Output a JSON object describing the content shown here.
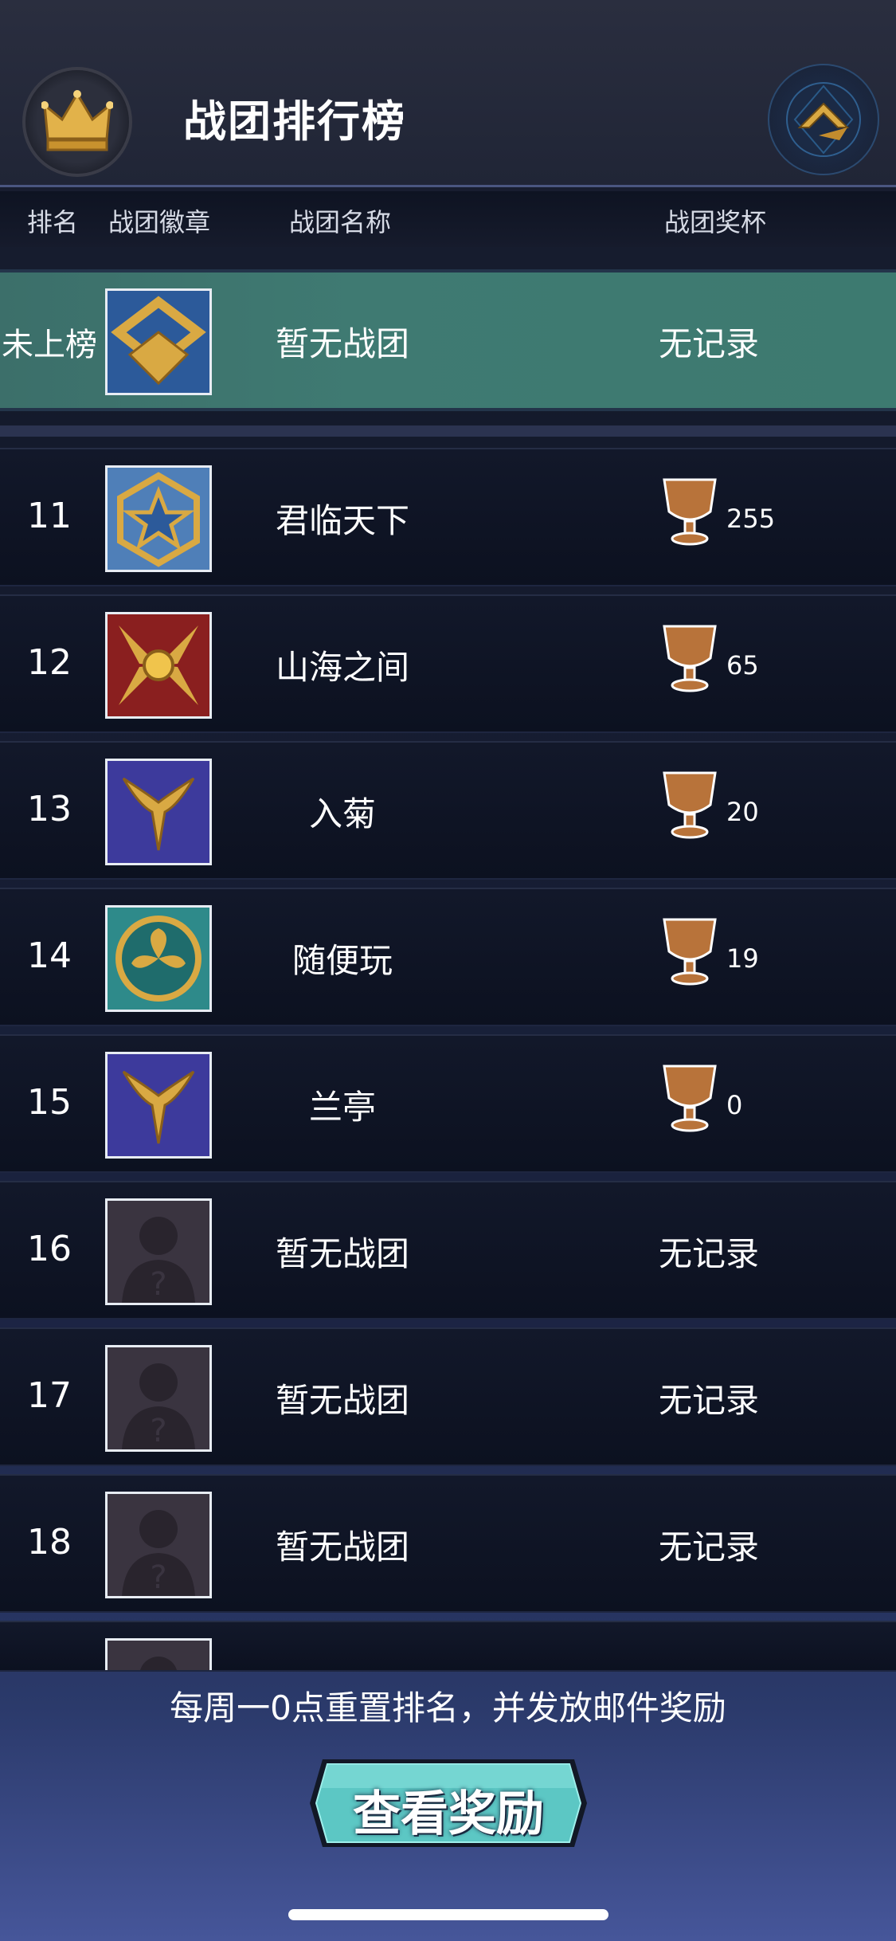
{
  "header": {
    "title": "战团排行榜"
  },
  "columns": {
    "rank": "排名",
    "badge": "战团徽章",
    "name": "战团名称",
    "trophy": "战团奖杯"
  },
  "my_row": {
    "rank": "未上榜",
    "name": "暂无战团",
    "trophy_text": "无记录"
  },
  "rows": [
    {
      "rank": "11",
      "name": "君临天下",
      "trophies": "255",
      "badge": "star-hex-emblem-icon"
    },
    {
      "rank": "12",
      "name": "山海之间",
      "trophies": "65",
      "badge": "sun-blades-emblem-icon"
    },
    {
      "rank": "13",
      "name": "入菊",
      "trophies": "20",
      "badge": "ram-horns-emblem-icon"
    },
    {
      "rank": "14",
      "name": "随便玩",
      "trophies": "19",
      "badge": "leaf-circle-emblem-icon"
    },
    {
      "rank": "15",
      "name": "兰亭",
      "trophies": "0",
      "badge": "ram-horns-emblem-icon"
    },
    {
      "rank": "16",
      "name": "暂无战团",
      "trophy_text": "无记录",
      "badge": "placeholder-avatar-icon"
    },
    {
      "rank": "17",
      "name": "暂无战团",
      "trophy_text": "无记录",
      "badge": "placeholder-avatar-icon"
    },
    {
      "rank": "18",
      "name": "暂无战团",
      "trophy_text": "无记录",
      "badge": "placeholder-avatar-icon"
    }
  ],
  "footer": {
    "notice": "每周一0点重置排名，并发放邮件奖励",
    "reward_button": "查看奖励"
  },
  "colors": {
    "my_row": "#3f7a72",
    "gold": "#d9a943",
    "bronze": "#b8733a",
    "button_teal": "#5cc7c4"
  }
}
